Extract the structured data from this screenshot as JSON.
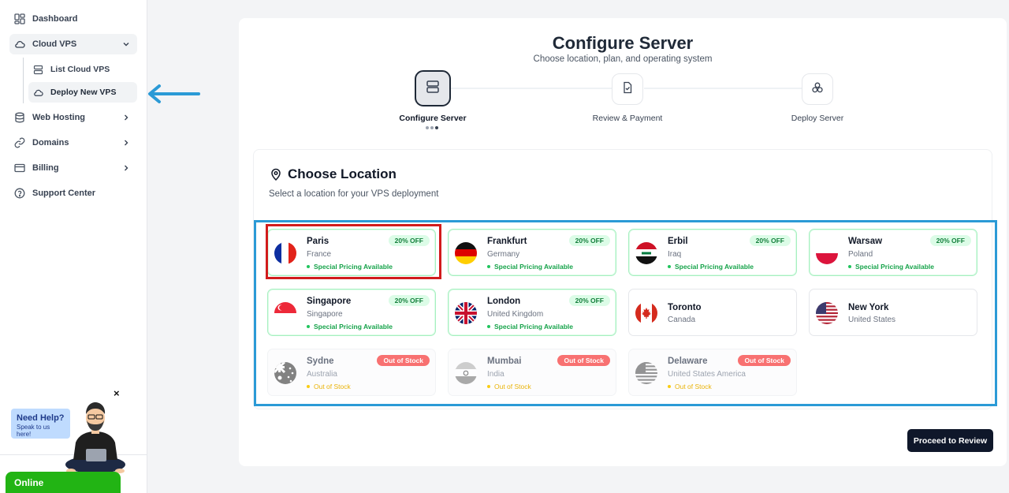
{
  "sidebar": {
    "items": [
      {
        "label": "Dashboard",
        "icon": "dashboard-icon"
      },
      {
        "label": "Cloud VPS",
        "icon": "cloud-icon",
        "expanded": true
      },
      {
        "label": "Web Hosting",
        "icon": "database-icon"
      },
      {
        "label": "Domains",
        "icon": "link-icon"
      },
      {
        "label": "Billing",
        "icon": "card-icon"
      },
      {
        "label": "Support Center",
        "icon": "help-icon"
      }
    ],
    "sub_items": [
      {
        "label": "List Cloud VPS",
        "icon": "server-icon"
      },
      {
        "label": "Deploy New VPS",
        "icon": "cloud-icon",
        "active": true
      }
    ]
  },
  "help": {
    "title": "Need Help?",
    "subtitle": "Speak to us here!",
    "close": "×",
    "status": "Online"
  },
  "header": {
    "title": "Configure Server",
    "subtitle": "Choose location, plan, and operating system"
  },
  "steps": [
    {
      "label": "Configure Server",
      "icon": "server-icon",
      "active": true
    },
    {
      "label": "Review & Payment",
      "icon": "file-check-icon"
    },
    {
      "label": "Deploy Server",
      "icon": "boxes-icon"
    }
  ],
  "location": {
    "title": "Choose Location",
    "description": "Select a location for your VPS deployment",
    "cards": [
      {
        "city": "Paris",
        "country": "France",
        "badge": "20% OFF",
        "note": "Special Pricing Available",
        "status": "offer",
        "flag": "fr",
        "selected": true
      },
      {
        "city": "Frankfurt",
        "country": "Germany",
        "badge": "20% OFF",
        "note": "Special Pricing Available",
        "status": "offer",
        "flag": "de"
      },
      {
        "city": "Erbil",
        "country": "Iraq",
        "badge": "20% OFF",
        "note": "Special Pricing Available",
        "status": "offer",
        "flag": "iq"
      },
      {
        "city": "Warsaw",
        "country": "Poland",
        "badge": "20% OFF",
        "note": "Special Pricing Available",
        "status": "offer",
        "flag": "pl"
      },
      {
        "city": "Singapore",
        "country": "Singapore",
        "badge": "20% OFF",
        "note": "Special Pricing Available",
        "status": "offer",
        "flag": "sg"
      },
      {
        "city": "London",
        "country": "United Kingdom",
        "badge": "20% OFF",
        "note": "Special Pricing Available",
        "status": "offer",
        "flag": "gb"
      },
      {
        "city": "Toronto",
        "country": "Canada",
        "status": "plain",
        "flag": "ca"
      },
      {
        "city": "New York",
        "country": "United States",
        "status": "plain",
        "flag": "us"
      },
      {
        "city": "Sydne",
        "country": "Australia",
        "badge": "Out of Stock",
        "note": "Out of Stock",
        "status": "oos",
        "flag": "au"
      },
      {
        "city": "Mumbai",
        "country": "India",
        "badge": "Out of Stock",
        "note": "Out of Stock",
        "status": "oos",
        "flag": "in"
      },
      {
        "city": "Delaware",
        "country": "United States America",
        "badge": "Out of Stock",
        "note": "Out of Stock",
        "status": "oos",
        "flag": "us"
      }
    ]
  },
  "actions": {
    "proceed": "Proceed to Review"
  },
  "colors": {
    "accent": "#0f172a",
    "offer_green": "#16a34a",
    "out_of_stock_red": "#f87171",
    "annotation_blue": "#2b9ad6",
    "annotation_red": "#d11c1c",
    "online_green": "#22b414"
  }
}
